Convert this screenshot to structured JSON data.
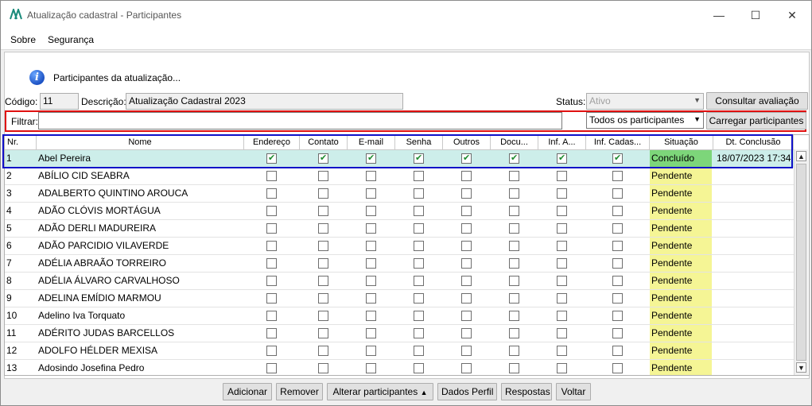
{
  "window": {
    "title": "Atualização cadastral - Participantes"
  },
  "window_controls": {
    "minimize": "—",
    "maximize": "☐",
    "close": "✕"
  },
  "menu": {
    "items": [
      "Sobre",
      "Segurança"
    ]
  },
  "info": {
    "text": "Participantes da atualização..."
  },
  "header": {
    "codigo_label": "Código:",
    "codigo_value": "11",
    "descricao_label": "Descrição:",
    "descricao_value": "Atualização Cadastral 2023",
    "status_label": "Status:",
    "status_value": "Ativo",
    "consultar_label": "Consultar avaliação"
  },
  "filter": {
    "label": "Filtrar:",
    "value": "",
    "combo_value": "Todos os participantes",
    "carregar_label": "Carregar participantes"
  },
  "grid": {
    "columns": [
      "Nr.",
      "Nome",
      "Endereço",
      "Contato",
      "E-mail",
      "Senha",
      "Outros",
      "Docu...",
      "Inf. A...",
      "Inf. Cadas...",
      "Situação",
      "Dt. Conclusão"
    ],
    "rows": [
      {
        "nr": "1",
        "nome": "Abel Pereira",
        "checks": [
          true,
          true,
          true,
          true,
          true,
          true,
          true,
          true
        ],
        "situacao": "Concluído",
        "dt": "18/07/2023 17:34"
      },
      {
        "nr": "2",
        "nome": "ABÍLIO CID SEABRA",
        "checks": [
          false,
          false,
          false,
          false,
          false,
          false,
          false,
          false
        ],
        "situacao": "Pendente",
        "dt": ""
      },
      {
        "nr": "3",
        "nome": "ADALBERTO QUINTINO AROUCA",
        "checks": [
          false,
          false,
          false,
          false,
          false,
          false,
          false,
          false
        ],
        "situacao": "Pendente",
        "dt": ""
      },
      {
        "nr": "4",
        "nome": "ADÃO CLÓVIS MORTÁGUA",
        "checks": [
          false,
          false,
          false,
          false,
          false,
          false,
          false,
          false
        ],
        "situacao": "Pendente",
        "dt": ""
      },
      {
        "nr": "5",
        "nome": "ADÃO DERLI MADUREIRA",
        "checks": [
          false,
          false,
          false,
          false,
          false,
          false,
          false,
          false
        ],
        "situacao": "Pendente",
        "dt": ""
      },
      {
        "nr": "6",
        "nome": "ADÃO PARCIDIO VILAVERDE",
        "checks": [
          false,
          false,
          false,
          false,
          false,
          false,
          false,
          false
        ],
        "situacao": "Pendente",
        "dt": ""
      },
      {
        "nr": "7",
        "nome": "ADÉLIA ABRAÃO TORREIRO",
        "checks": [
          false,
          false,
          false,
          false,
          false,
          false,
          false,
          false
        ],
        "situacao": "Pendente",
        "dt": ""
      },
      {
        "nr": "8",
        "nome": "ADÉLIA ÁLVARO CARVALHOSO",
        "checks": [
          false,
          false,
          false,
          false,
          false,
          false,
          false,
          false
        ],
        "situacao": "Pendente",
        "dt": ""
      },
      {
        "nr": "9",
        "nome": "ADELINA EMÍDIO MARMOU",
        "checks": [
          false,
          false,
          false,
          false,
          false,
          false,
          false,
          false
        ],
        "situacao": "Pendente",
        "dt": ""
      },
      {
        "nr": "10",
        "nome": "Adelino Iva Torquato",
        "checks": [
          false,
          false,
          false,
          false,
          false,
          false,
          false,
          false
        ],
        "situacao": "Pendente",
        "dt": ""
      },
      {
        "nr": "11",
        "nome": "ADÉRITO JUDAS BARCELLOS",
        "checks": [
          false,
          false,
          false,
          false,
          false,
          false,
          false,
          false
        ],
        "situacao": "Pendente",
        "dt": ""
      },
      {
        "nr": "12",
        "nome": "ADOLFO HÉLDER MEXISA",
        "checks": [
          false,
          false,
          false,
          false,
          false,
          false,
          false,
          false
        ],
        "situacao": "Pendente",
        "dt": ""
      },
      {
        "nr": "13",
        "nome": "Adosindo Josefina Pedro",
        "checks": [
          false,
          false,
          false,
          false,
          false,
          false,
          false,
          false
        ],
        "situacao": "Pendente",
        "dt": ""
      }
    ]
  },
  "buttons": {
    "adicionar": "Adicionar",
    "remover": "Remover",
    "alterar": "Alterar participantes",
    "dados_perfil": "Dados Perfil",
    "respostas": "Respostas",
    "voltar": "Voltar"
  },
  "colors": {
    "concluido": "#7dd67a",
    "pendente": "#f5f595",
    "selected_row": "#cdeeea",
    "highlight_red": "#e01010",
    "highlight_blue": "#1010c8"
  }
}
